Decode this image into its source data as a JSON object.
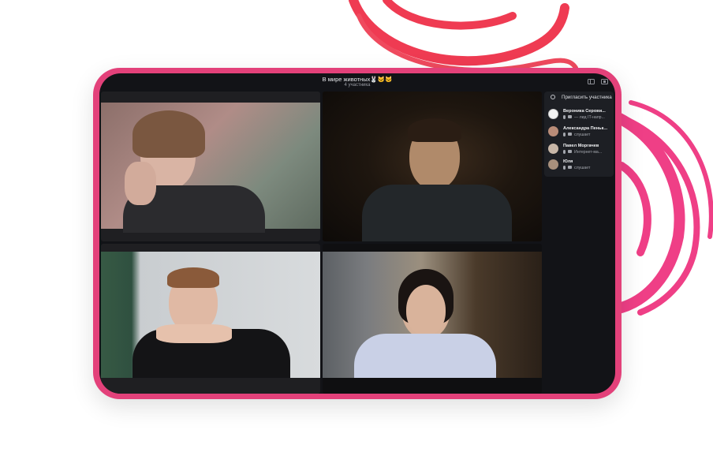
{
  "window": {
    "title": "В мире животных🐰🐱🐱",
    "subtitle": "4 участника"
  },
  "sidebar": {
    "invite_label": "Пригласить участника",
    "participants": [
      {
        "name": "Вероника Серови...",
        "status": "— лид IT-напр..."
      },
      {
        "name": "Александра Пеньк...",
        "status": "слушает"
      },
      {
        "name": "Павел Моргачев",
        "status": "Интернет-ма..."
      },
      {
        "name": "Юля",
        "status": "слушает"
      }
    ]
  },
  "video_tiles": [
    {
      "participant": "Вероника Серови..."
    },
    {
      "participant": "Александра Пеньк..."
    },
    {
      "participant": "Павел Моргачев"
    },
    {
      "participant": "Юля"
    }
  ],
  "colors": {
    "device_frame": "#e3417a",
    "screen_bg": "#121317",
    "panel_bg": "#1d1f24",
    "deco_red": "#ef3b52",
    "deco_pink": "#ef3f86"
  },
  "icons": [
    "invite-user-icon",
    "sidebar-toggle-icon",
    "fullscreen-icon",
    "mic-icon",
    "camera-icon"
  ]
}
